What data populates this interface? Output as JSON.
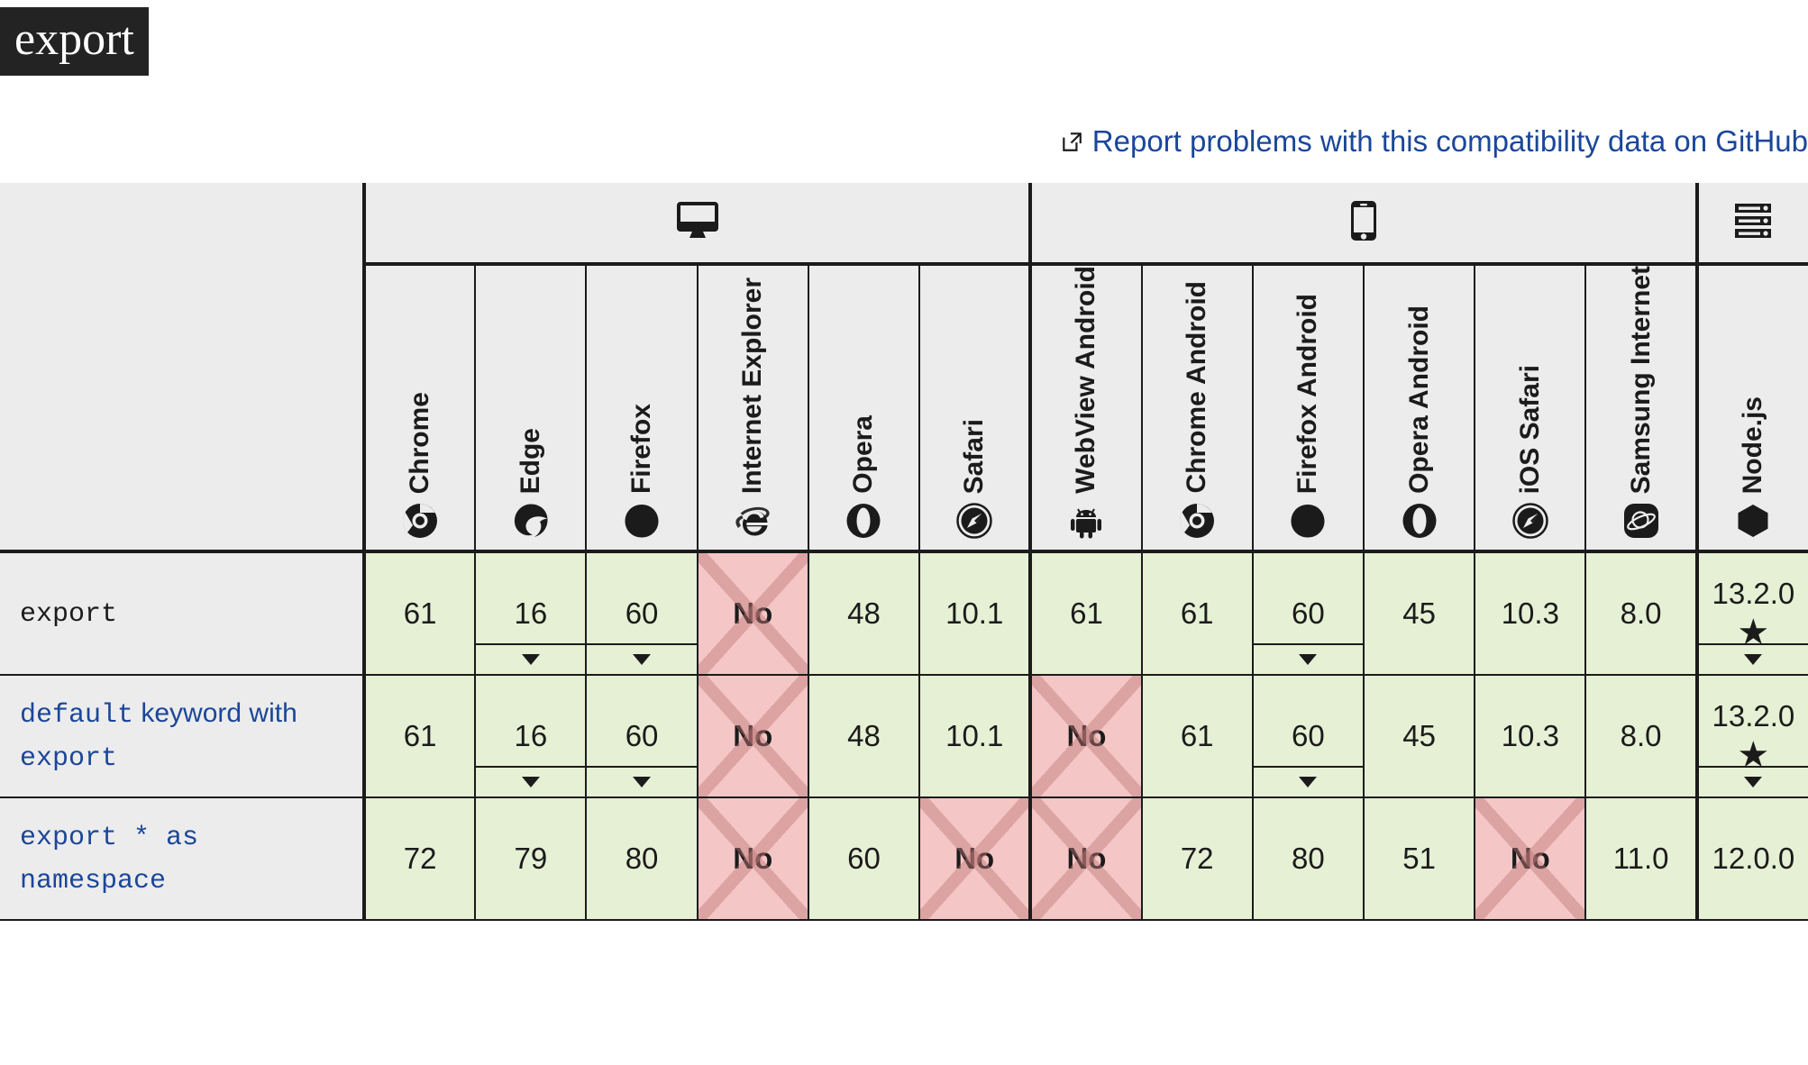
{
  "header": {
    "title": "export",
    "report_link": {
      "label": "Report problems with this compatibility data on GitHub",
      "icon": "external-link-icon"
    }
  },
  "table": {
    "groups": [
      {
        "name": "desktop",
        "icon": "desktop-monitor-icon",
        "span": 6
      },
      {
        "name": "mobile",
        "icon": "mobile-phone-icon",
        "span": 6
      },
      {
        "name": "server",
        "icon": "server-rack-icon",
        "span": 1
      }
    ],
    "browsers": [
      {
        "name": "Chrome",
        "icon": "chrome-logo-icon"
      },
      {
        "name": "Edge",
        "icon": "edge-logo-icon"
      },
      {
        "name": "Firefox",
        "icon": "firefox-logo-icon"
      },
      {
        "name": "Internet Explorer",
        "icon": "internet-explorer-logo-icon"
      },
      {
        "name": "Opera",
        "icon": "opera-logo-icon"
      },
      {
        "name": "Safari",
        "icon": "safari-logo-icon"
      },
      {
        "name": "WebView Android",
        "icon": "android-logo-icon"
      },
      {
        "name": "Chrome Android",
        "icon": "chrome-logo-icon"
      },
      {
        "name": "Firefox Android",
        "icon": "firefox-logo-icon"
      },
      {
        "name": "Opera Android",
        "icon": "opera-logo-icon"
      },
      {
        "name": "iOS Safari",
        "icon": "safari-logo-icon"
      },
      {
        "name": "Samsung Internet",
        "icon": "samsung-internet-logo-icon"
      },
      {
        "name": "Node.js",
        "icon": "nodejs-logo-icon"
      }
    ],
    "rows": [
      {
        "feature": {
          "parts": [
            {
              "text": "export",
              "style": "mono"
            }
          ]
        },
        "cells": [
          {
            "value": "61",
            "support": "yes",
            "toggle": false,
            "note": ""
          },
          {
            "value": "16",
            "support": "yes",
            "toggle": true,
            "note": ""
          },
          {
            "value": "60",
            "support": "yes",
            "toggle": true,
            "note": ""
          },
          {
            "value": "No",
            "support": "no",
            "toggle": false,
            "note": ""
          },
          {
            "value": "48",
            "support": "yes",
            "toggle": false,
            "note": ""
          },
          {
            "value": "10.1",
            "support": "yes",
            "toggle": false,
            "note": ""
          },
          {
            "value": "61",
            "support": "yes",
            "toggle": false,
            "note": ""
          },
          {
            "value": "61",
            "support": "yes",
            "toggle": false,
            "note": ""
          },
          {
            "value": "60",
            "support": "yes",
            "toggle": true,
            "note": ""
          },
          {
            "value": "45",
            "support": "yes",
            "toggle": false,
            "note": ""
          },
          {
            "value": "10.3",
            "support": "yes",
            "toggle": false,
            "note": ""
          },
          {
            "value": "8.0",
            "support": "yes",
            "toggle": false,
            "note": ""
          },
          {
            "value": "13.2.0",
            "support": "yes",
            "toggle": true,
            "note": "★"
          }
        ]
      },
      {
        "feature": {
          "parts": [
            {
              "text": "default",
              "style": "mono"
            },
            {
              "text": " keyword with ",
              "style": "sans"
            },
            {
              "text": "export",
              "style": "mono"
            }
          ]
        },
        "cells": [
          {
            "value": "61",
            "support": "yes",
            "toggle": false,
            "note": ""
          },
          {
            "value": "16",
            "support": "yes",
            "toggle": true,
            "note": ""
          },
          {
            "value": "60",
            "support": "yes",
            "toggle": true,
            "note": ""
          },
          {
            "value": "No",
            "support": "no",
            "toggle": false,
            "note": ""
          },
          {
            "value": "48",
            "support": "yes",
            "toggle": false,
            "note": ""
          },
          {
            "value": "10.1",
            "support": "yes",
            "toggle": false,
            "note": ""
          },
          {
            "value": "No",
            "support": "no",
            "toggle": false,
            "note": ""
          },
          {
            "value": "61",
            "support": "yes",
            "toggle": false,
            "note": ""
          },
          {
            "value": "60",
            "support": "yes",
            "toggle": true,
            "note": ""
          },
          {
            "value": "45",
            "support": "yes",
            "toggle": false,
            "note": ""
          },
          {
            "value": "10.3",
            "support": "yes",
            "toggle": false,
            "note": ""
          },
          {
            "value": "8.0",
            "support": "yes",
            "toggle": false,
            "note": ""
          },
          {
            "value": "13.2.0",
            "support": "yes",
            "toggle": true,
            "note": "★"
          }
        ]
      },
      {
        "feature": {
          "parts": [
            {
              "text": "export * as namespace",
              "style": "mono"
            }
          ]
        },
        "cells": [
          {
            "value": "72",
            "support": "yes",
            "toggle": false,
            "note": ""
          },
          {
            "value": "79",
            "support": "yes",
            "toggle": false,
            "note": ""
          },
          {
            "value": "80",
            "support": "yes",
            "toggle": false,
            "note": ""
          },
          {
            "value": "No",
            "support": "no",
            "toggle": false,
            "note": ""
          },
          {
            "value": "60",
            "support": "yes",
            "toggle": false,
            "note": ""
          },
          {
            "value": "No",
            "support": "no",
            "toggle": false,
            "note": ""
          },
          {
            "value": "No",
            "support": "no",
            "toggle": false,
            "note": ""
          },
          {
            "value": "72",
            "support": "yes",
            "toggle": false,
            "note": ""
          },
          {
            "value": "80",
            "support": "yes",
            "toggle": false,
            "note": ""
          },
          {
            "value": "51",
            "support": "yes",
            "toggle": false,
            "note": ""
          },
          {
            "value": "No",
            "support": "no",
            "toggle": false,
            "note": ""
          },
          {
            "value": "11.0",
            "support": "yes",
            "toggle": false,
            "note": ""
          },
          {
            "value": "12.0.0",
            "support": "yes",
            "toggle": false,
            "note": ""
          }
        ]
      }
    ]
  },
  "colors": {
    "yes_bg": "#e6f0d4",
    "no_bg": "#f5c6c6",
    "header_bg": "#ececec",
    "link": "#1b4699",
    "title_bg": "#232323"
  }
}
